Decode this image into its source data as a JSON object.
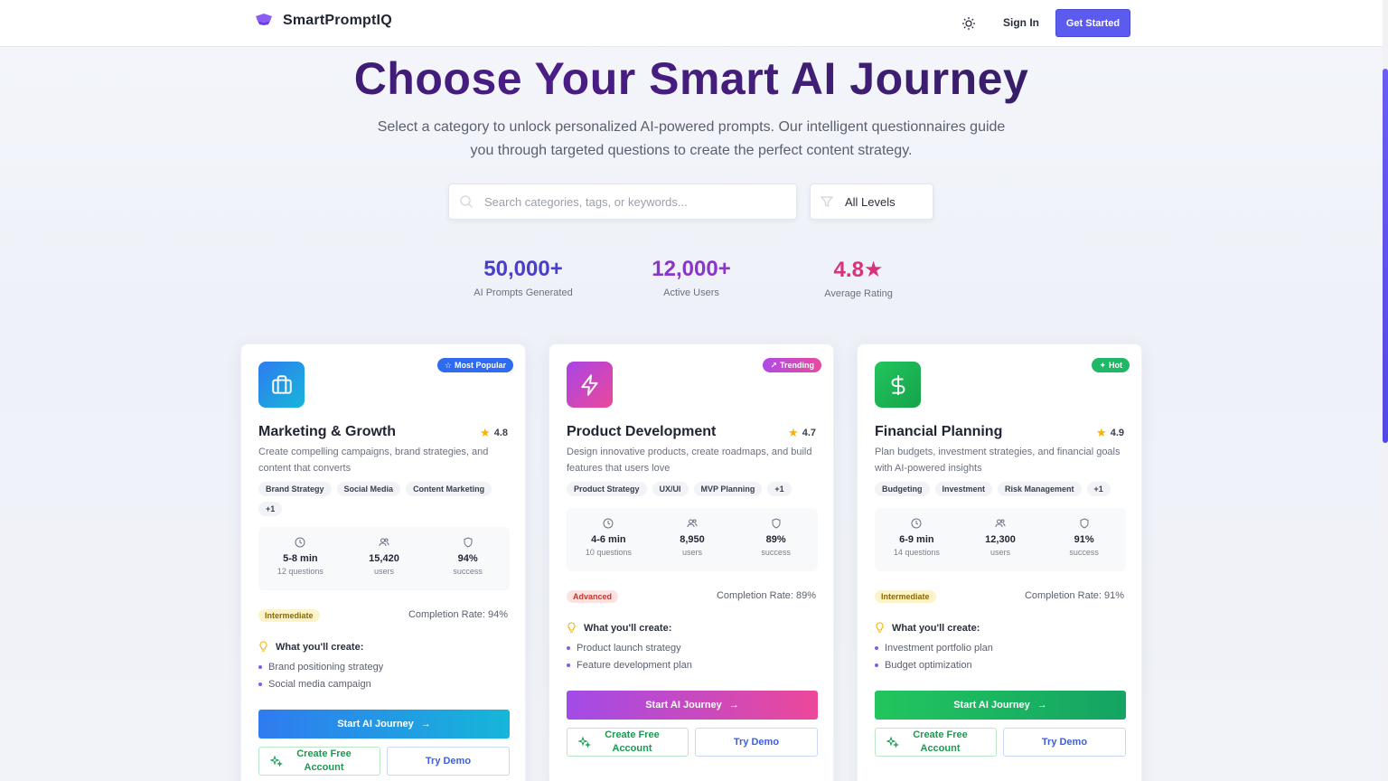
{
  "header": {
    "brand": "SmartPromptIQ",
    "signin_label": "Sign In",
    "getstarted_label": "Get Started",
    "accent": "#5b5bf0"
  },
  "hero": {
    "title": "Choose Your Smart AI Journey",
    "subtitle": "Select a category to unlock personalized AI-powered prompts. Our intelligent questionnaires guide you through targeted questions to create the perfect content strategy.",
    "search_placeholder": "Search categories, tags, or keywords...",
    "level_filter": "All Levels"
  },
  "stats": [
    {
      "value": "50,000+",
      "label": "AI Prompts Generated",
      "color": "#4a3fc9"
    },
    {
      "value": "12,000+",
      "label": "Active Users",
      "color": "#8a36c9"
    },
    {
      "value": "4.8★",
      "label": "Average Rating",
      "color": "#d6337a"
    }
  ],
  "cards": [
    {
      "title": "Marketing & Growth",
      "rating": "4.8",
      "badge": "Most Popular",
      "description": "Create compelling campaigns, brand strategies, and content that converts",
      "tags": [
        "Brand Strategy",
        "Social Media",
        "Content Marketing",
        "+1"
      ],
      "time": "5-8 min",
      "questions": "12 questions",
      "users": "15,420",
      "users_label": "users",
      "success": "94%",
      "success_label": "success",
      "level": "Intermediate",
      "completion": "Completion Rate: 94%",
      "create_heading": "What you'll create:",
      "bullets": [
        "Brand positioning strategy",
        "Social media campaign"
      ],
      "start_label": "Start AI Journey",
      "free_label": "Create Free Account",
      "demo_label": "Try Demo",
      "color": "#2f7bf0"
    },
    {
      "title": "Product Development",
      "rating": "4.7",
      "badge": "Trending",
      "description": "Design innovative products, create roadmaps, and build features that users love",
      "tags": [
        "Product Strategy",
        "UX/UI",
        "MVP Planning",
        "+1"
      ],
      "time": "4-6 min",
      "questions": "10 questions",
      "users": "8,950",
      "users_label": "users",
      "success": "89%",
      "success_label": "success",
      "level": "Advanced",
      "completion": "Completion Rate: 89%",
      "create_heading": "What you'll create:",
      "bullets": [
        "Product launch strategy",
        "Feature development plan"
      ],
      "start_label": "Start AI Journey",
      "free_label": "Create Free Account",
      "demo_label": "Try Demo",
      "color": "#a845e6"
    },
    {
      "title": "Financial Planning",
      "rating": "4.9",
      "badge": "Hot",
      "description": "Plan budgets, investment strategies, and financial goals with AI-powered insights",
      "tags": [
        "Budgeting",
        "Investment",
        "Risk Management",
        "+1"
      ],
      "time": "6-9 min",
      "questions": "14 questions",
      "users": "12,300",
      "users_label": "users",
      "success": "91%",
      "success_label": "success",
      "level": "Intermediate",
      "completion": "Completion Rate: 91%",
      "create_heading": "What you'll create:",
      "bullets": [
        "Investment portfolio plan",
        "Budget optimization"
      ],
      "start_label": "Start AI Journey",
      "free_label": "Create Free Account",
      "demo_label": "Try Demo",
      "color": "#1fb866"
    }
  ]
}
